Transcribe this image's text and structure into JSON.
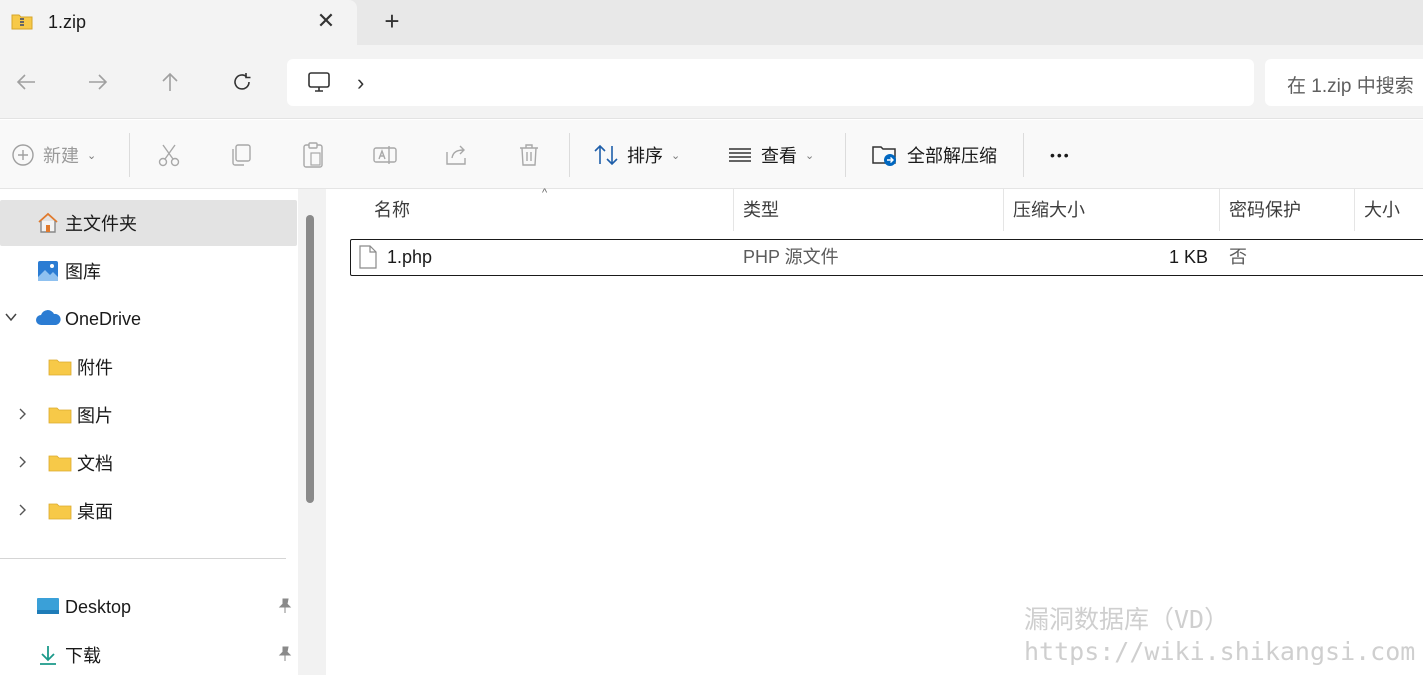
{
  "tab": {
    "title": "1.zip",
    "close_glyph": "✕",
    "new_glyph": "+",
    "icon": "zip-folder-icon"
  },
  "nav": {
    "back_icon": "back-arrow-icon",
    "forward_icon": "forward-arrow-icon",
    "up_icon": "up-arrow-icon",
    "refresh_icon": "refresh-icon",
    "address_icon": "this-pc-icon",
    "address_chevron": "›",
    "search_placeholder": "在 1.zip 中搜索"
  },
  "commands": {
    "new_label": "新建",
    "sort_label": "排序",
    "view_label": "查看",
    "extract_all_label": "全部解压缩",
    "more_glyph": "•••",
    "caret": "⌄"
  },
  "sidebar": {
    "home": "主文件夹",
    "gallery": "图库",
    "onedrive": "OneDrive",
    "folders": [
      "附件",
      "图片",
      "文档",
      "桌面"
    ],
    "pinned": [
      "Desktop",
      "下载"
    ]
  },
  "columns": [
    "名称",
    "类型",
    "压缩大小",
    "密码保护",
    "大小"
  ],
  "files": [
    {
      "name": "1.php",
      "type": "PHP 源文件",
      "compressed_size": "1 KB",
      "password_protected": "否",
      "size": ""
    }
  ],
  "watermark": {
    "line1": "漏洞数据库（VD）",
    "line2": "https://wiki.shikangsi.com"
  },
  "colors": {
    "folder": "#f7c948",
    "onedrive": "#2b7cd3",
    "accent": "#0067c0",
    "selected": "#e3e3e3"
  }
}
